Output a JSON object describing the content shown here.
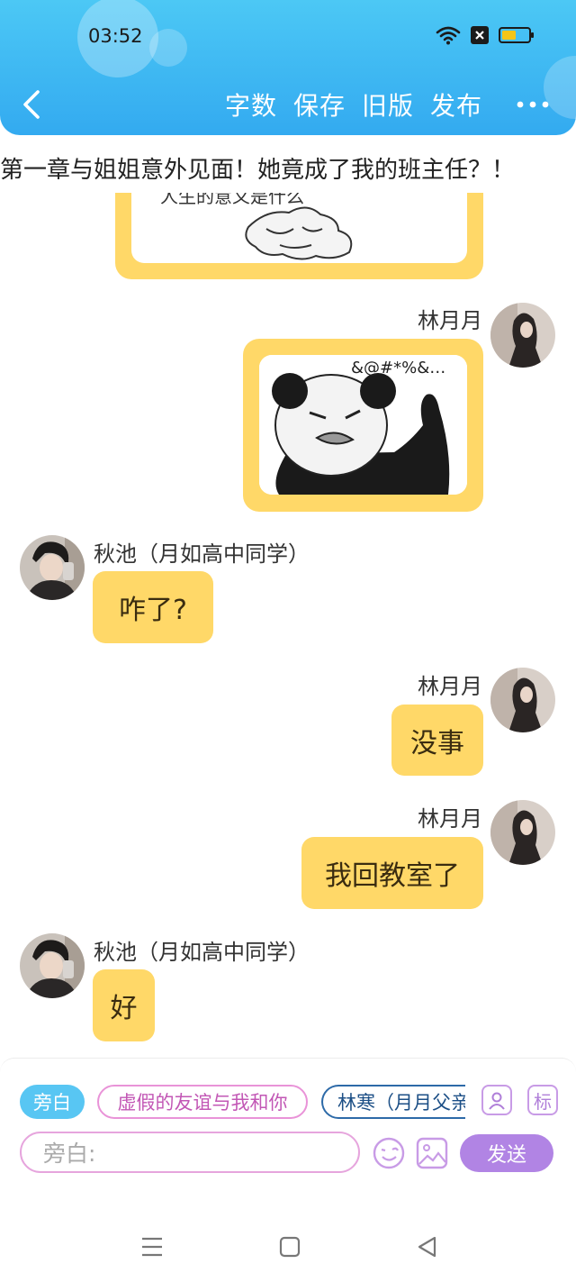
{
  "status_bar": {
    "time": "03:52"
  },
  "header": {
    "menu": [
      "字数",
      "保存",
      "旧版",
      "发布"
    ]
  },
  "chapter": {
    "title": "第一章与姐姐意外见面！她竟成了我的班主任？！"
  },
  "top_image": {
    "caption_fragment": "人生的意义是什么"
  },
  "messages": [
    {
      "side": "right",
      "name": "林月月",
      "type": "image",
      "caption": "&@#*%&…"
    },
    {
      "side": "left",
      "name": "秋池（月如高中同学）",
      "type": "text",
      "text": "咋了?"
    },
    {
      "side": "right",
      "name": "林月月",
      "type": "text",
      "text": "没事"
    },
    {
      "side": "right",
      "name": "林月月",
      "type": "text",
      "text": "我回教室了"
    },
    {
      "side": "left",
      "name": "秋池（月如高中同学）",
      "type": "text",
      "text": "好"
    }
  ],
  "input_panel": {
    "roles": [
      "旁白",
      "虚假的友谊与我和你",
      "林寒（月月父亲"
    ],
    "tools": {
      "label_tool": "标"
    },
    "placeholder": "旁白:",
    "send_label": "发送"
  },
  "colors": {
    "header": "#33aaf0",
    "bubble": "#ffd868",
    "send": "#b184e4"
  }
}
